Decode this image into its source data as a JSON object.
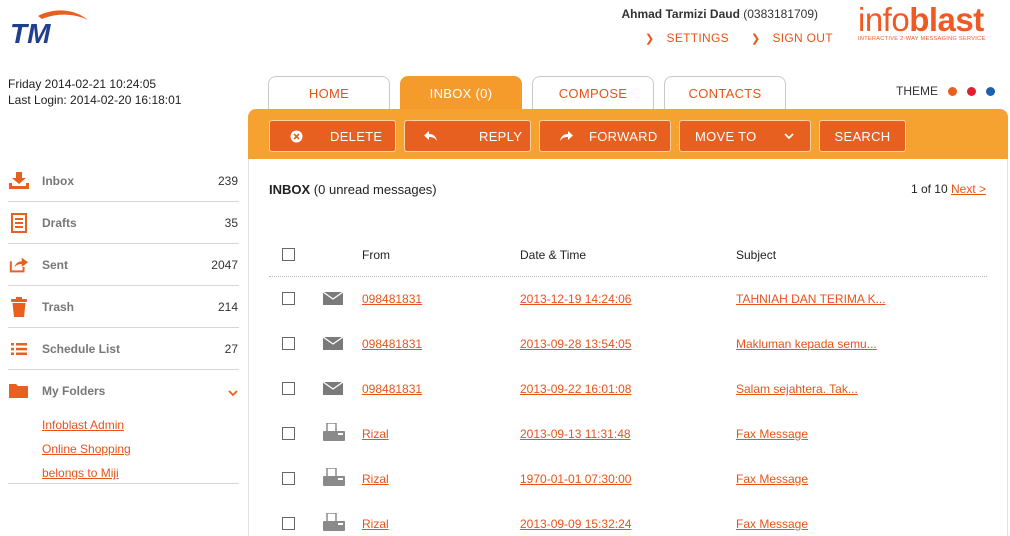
{
  "header": {
    "user_name": "Ahmad Tarmizi Daud",
    "user_phone": "(0383181709)",
    "settings_label": "SETTINGS",
    "signout_label": "SIGN OUT",
    "brand_part1": "info",
    "brand_part2": "blast",
    "brand_tagline": "INTERACTIVE 2-WAY MESSAGING SERVICE",
    "tm_logo_text": "TM"
  },
  "session": {
    "current_datetime": "Friday 2014-02-21 10:24:05",
    "last_login": "Last Login: 2014-02-20 16:18:01"
  },
  "tabs": [
    {
      "label": "HOME"
    },
    {
      "label": "INBOX (0)"
    },
    {
      "label": "COMPOSE"
    },
    {
      "label": "CONTACTS"
    }
  ],
  "theme": {
    "label": "THEME",
    "colors": [
      "#e8601f",
      "#e0202e",
      "#1e5fb0"
    ]
  },
  "toolbar": {
    "delete_label": "DELETE",
    "reply_label": "REPLY",
    "forward_label": "FORWARD",
    "moveto_label": "MOVE TO",
    "search_label": "SEARCH"
  },
  "inbox": {
    "title": "INBOX",
    "subtitle": "(0 unread messages)",
    "pager_text": "1 of 10",
    "next_label": "Next >"
  },
  "table": {
    "headers": {
      "from": "From",
      "date": "Date & Time",
      "subject": "Subject"
    },
    "rows": [
      {
        "icon": "envelope-icon",
        "from": "098481831",
        "date": "2013-12-19 14:24:06",
        "subject": "TAHNIAH DAN TERIMA K..."
      },
      {
        "icon": "envelope-icon",
        "from": "098481831",
        "date": "2013-09-28 13:54:05",
        "subject": "Makluman kepada semu..."
      },
      {
        "icon": "envelope-icon",
        "from": "098481831",
        "date": "2013-09-22 16:01:08",
        "subject": "Salam sejahtera. Tak..."
      },
      {
        "icon": "fax-icon",
        "from": "Rizal",
        "date": "2013-09-13 11:31:48",
        "subject": "Fax Message"
      },
      {
        "icon": "fax-icon",
        "from": "Rizal",
        "date": "1970-01-01 07:30:00",
        "subject": "Fax Message"
      },
      {
        "icon": "fax-icon",
        "from": "Rizal",
        "date": "2013-09-09 15:32:24",
        "subject": "Fax Message"
      }
    ]
  },
  "sidebar": {
    "items": [
      {
        "label": "Inbox",
        "count": "239",
        "icon": "inbox-download-icon"
      },
      {
        "label": "Drafts",
        "count": "35",
        "icon": "document-icon"
      },
      {
        "label": "Sent",
        "count": "2047",
        "icon": "share-arrow-icon"
      },
      {
        "label": "Trash",
        "count": "214",
        "icon": "trash-icon"
      },
      {
        "label": "Schedule List",
        "count": "27",
        "icon": "list-icon"
      }
    ],
    "folders_label": "My Folders",
    "folders": [
      "Infoblast Admin",
      "Online Shopping",
      "belongs to Miji"
    ]
  }
}
